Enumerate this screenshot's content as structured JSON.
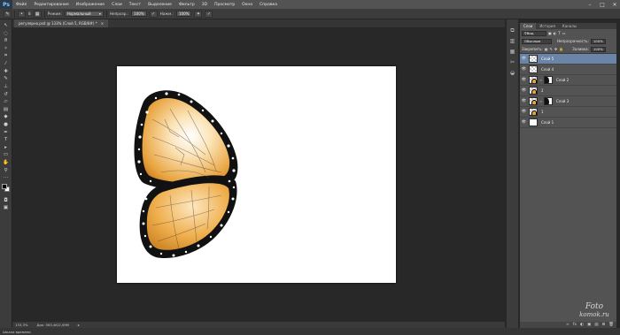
{
  "app": {
    "logo": "Ps"
  },
  "menu": [
    "Файл",
    "Редактирование",
    "Изображение",
    "Слои",
    "Текст",
    "Выделение",
    "Фильтр",
    "3D",
    "Просмотр",
    "Окно",
    "Справка"
  ],
  "window_controls": {
    "minimize": "–",
    "maximize": "□",
    "close": "✕"
  },
  "options": {
    "brush_size": "8",
    "mode_label": "Режим:",
    "mode_value": "Нормальный",
    "opacity_label": "Непрозр.:",
    "opacity_value": "100%",
    "flow_label": "Нажм.:",
    "flow_value": "100%"
  },
  "document": {
    "tab_title": "регулярно.psd @ 133% (Слой 5, RGB/8#) *",
    "close": "×"
  },
  "status": {
    "zoom": "133,3%",
    "doc_info": "Док: 563,4K/2,09M"
  },
  "bottom": {
    "label": "Шкала времени"
  },
  "panel": {
    "tabs": [
      "Слои",
      "История",
      "Каналы"
    ],
    "kind_value": "Вид",
    "blend_mode": "Обычные",
    "opacity_label": "Непрозрачность:",
    "opacity_value": "100%",
    "lock_label": "Закрепить:",
    "fill_label": "Заливка:",
    "fill_value": "100%",
    "footer_icons": [
      "∞",
      "fx",
      "◐",
      "▣",
      "▤",
      "⊞",
      "🗑"
    ],
    "layers": [
      {
        "name": "Слой 5",
        "thumb": "checker",
        "mask": false,
        "selected": true
      },
      {
        "name": "Слой 4",
        "thumb": "checker",
        "mask": false,
        "selected": false
      },
      {
        "name": "Слой 2",
        "thumb": "bfly",
        "mask": true,
        "selected": false
      },
      {
        "name": "2",
        "thumb": "bfly",
        "mask": false,
        "selected": false
      },
      {
        "name": "Слой 3",
        "thumb": "bfly",
        "mask": true,
        "selected": false
      },
      {
        "name": "1",
        "thumb": "bfly",
        "mask": false,
        "selected": false
      },
      {
        "name": "Слой 1",
        "thumb": "white",
        "mask": false,
        "selected": false
      }
    ]
  },
  "watermark": {
    "line1": "Foto",
    "line2": "komok.ru"
  },
  "colors": {
    "accent": "#6a85a8",
    "wing": "#e7a53a",
    "canvas": "#ffffff"
  }
}
